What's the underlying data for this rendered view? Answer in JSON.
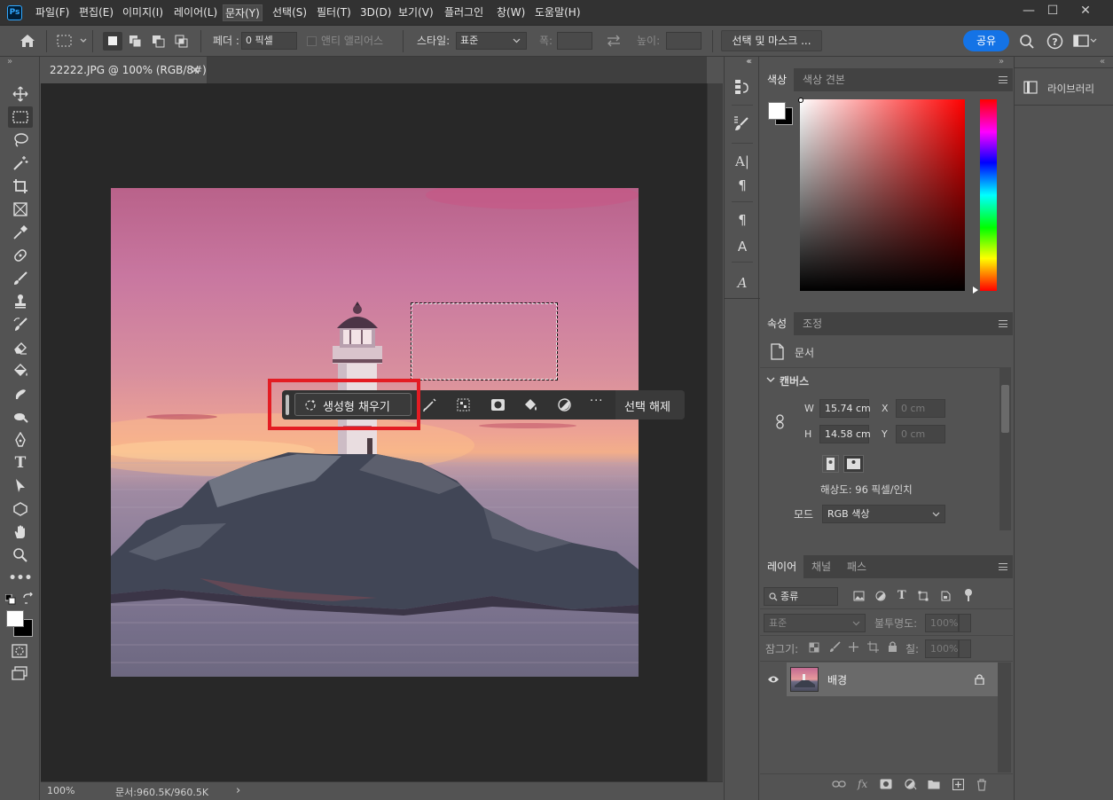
{
  "app": {
    "logo": "Ps"
  },
  "menu": {
    "items": [
      "파일(F)",
      "편집(E)",
      "이미지(I)",
      "레이어(L)",
      "문자(Y)",
      "선택(S)",
      "필터(T)",
      "3D(D)",
      "보기(V)",
      "플러그인",
      "창(W)",
      "도움말(H)"
    ],
    "active_index": 4,
    "window_controls": [
      "—",
      "☐",
      "✕"
    ]
  },
  "options_bar": {
    "home_icon": "home-icon",
    "feather_label": "페더 :",
    "feather_value": "0 픽셀",
    "antialias_label": "앤티 앨리어스",
    "style_label": "스타일:",
    "style_value": "표준",
    "width_label": "폭:",
    "height_label": "높이:",
    "select_mask_button": "선택 및 마스크 ...",
    "share_button": "공유",
    "colors": {
      "share": "#1473e6"
    }
  },
  "document": {
    "tab_title": "22222.JPG @ 100% (RGB/8#)",
    "close_glyph": "×",
    "zoom": "100%",
    "doc_info": "문서:960.5K/960.5K",
    "status_arrow": "›"
  },
  "taskbar": {
    "generative_fill": "생성형 채우기",
    "deselect": "선택 해제",
    "more": "···",
    "highlight_color": "#e31c23"
  },
  "panels": {
    "color": {
      "tabs": [
        "색상",
        "색상 견본"
      ],
      "active_tab": 0
    },
    "properties": {
      "tabs": [
        "속성",
        "조정"
      ],
      "active_tab": 0,
      "doc_label": "문서",
      "canvas_section": "캔버스",
      "w_label": "W",
      "w_value": "15.74 cm",
      "h_label": "H",
      "h_value": "14.58 cm",
      "x_label": "X",
      "x_value": "0 cm",
      "y_label": "Y",
      "y_value": "0 cm",
      "resolution": "해상도: 96 픽셀/인치",
      "mode_label": "모드",
      "mode_value": "RGB 색상"
    },
    "layers": {
      "tabs": [
        "레이어",
        "채널",
        "패스"
      ],
      "active_tab": 0,
      "filter_label": "종류",
      "blend_mode": "표준",
      "opacity_label": "불투명도:",
      "opacity_value": "100%",
      "lock_label": "잠그기:",
      "fill_label": "칠:",
      "fill_value": "100%",
      "layer_name": "배경",
      "bottom_fx": "fx"
    },
    "libraries": {
      "label": "라이브러리"
    }
  },
  "collapse_glyphs": {
    "left": "»",
    "right_a": "«",
    "right_b": "»",
    "right_c": "«"
  }
}
